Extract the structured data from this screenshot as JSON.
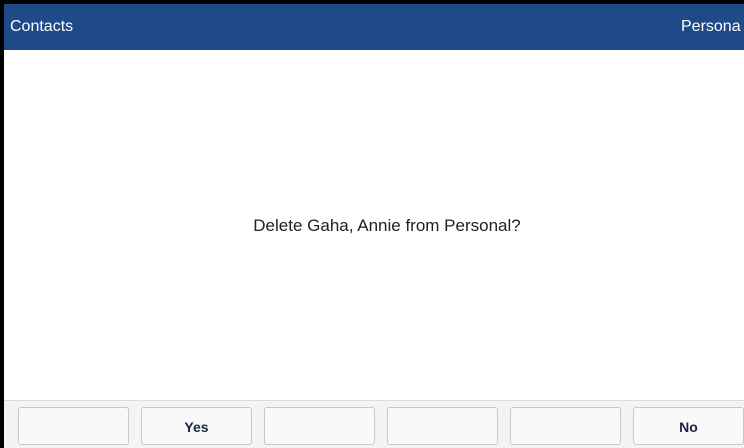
{
  "header": {
    "title": "Contacts",
    "folder": "Persona"
  },
  "dialog": {
    "message": "Delete Gaha, Annie from Personal?"
  },
  "softkeys": [
    {
      "label": ""
    },
    {
      "label": "Yes"
    },
    {
      "label": ""
    },
    {
      "label": ""
    },
    {
      "label": ""
    },
    {
      "label": "No"
    }
  ],
  "colors": {
    "header_bg": "#1f4a8a",
    "header_text": "#ffffff"
  }
}
